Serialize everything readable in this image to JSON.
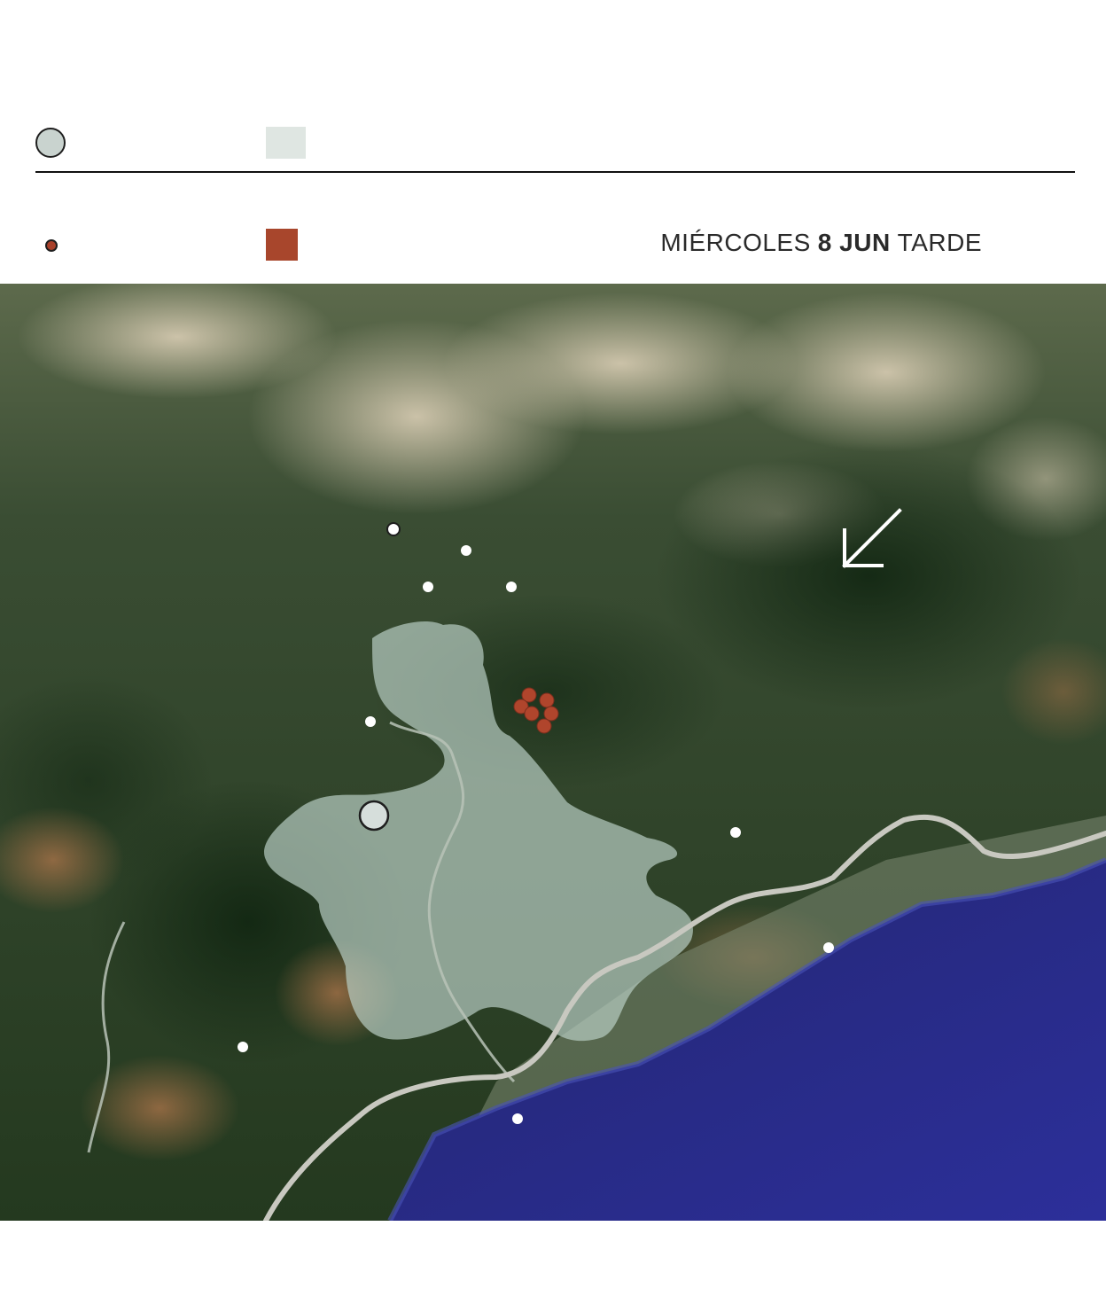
{
  "legend": {
    "row1": {
      "circle_label": "",
      "square_label": ""
    },
    "row2": {
      "circle_label": "",
      "square_label": ""
    },
    "colors": {
      "large_circle": "#c9d3cf",
      "pale_area": "#dfe6e2",
      "small_circle": "#a8402a",
      "fire_area": "#a8462c"
    }
  },
  "date": {
    "weekday": "MIÉRCOLES",
    "day_month": "8 JUN",
    "period": "TARDE"
  },
  "map": {
    "basemap": "satellite",
    "wind_arrow_icon": "arrow-down-left-icon",
    "colors": {
      "sea": "#2a2c8c",
      "forest": "#1f3a22",
      "burned_area": "#b9cbc2",
      "road": "#c8c8c0",
      "fire_point": "#b0452c",
      "town_point": "#ffffff"
    }
  }
}
